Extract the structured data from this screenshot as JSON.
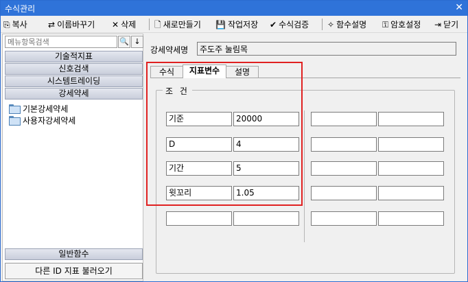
{
  "window": {
    "title": "수식관리",
    "close": "✕"
  },
  "toolbar": {
    "items": [
      {
        "icon": "copy-icon",
        "glyph": "⎘",
        "label": "복사"
      },
      {
        "icon": "rename-icon",
        "glyph": "⇄",
        "label": "이름바꾸기"
      },
      {
        "icon": "delete-icon",
        "glyph": "✕",
        "label": "삭제"
      },
      {
        "icon": "new-document-icon",
        "glyph": "🗋",
        "label": "새로만들기"
      },
      {
        "icon": "save-icon",
        "glyph": "💾",
        "label": "작업저장"
      },
      {
        "icon": "check-icon",
        "glyph": "✔",
        "label": "수식검증"
      },
      {
        "icon": "magic-wand-icon",
        "glyph": "✧",
        "label": "함수설명"
      },
      {
        "icon": "key-icon",
        "glyph": "⚿",
        "label": "암호설정"
      },
      {
        "icon": "exit-icon",
        "glyph": "⇥",
        "label": "닫기"
      }
    ]
  },
  "sidebar": {
    "search_placeholder": "메뉴항목검색",
    "search_glyph": "🔍",
    "down_glyph": "↓",
    "categories": [
      "기술적지표",
      "신호검색",
      "시스템트레이딩",
      "강세약세"
    ],
    "tree": [
      "기본강세약세",
      "사용자강세약세"
    ],
    "bottom_category": "일반함수",
    "load_button": "다른 ID 지표 불러오기"
  },
  "main": {
    "name_label": "강세약세명",
    "name_value": "주도주 눌림목",
    "tabs": [
      "수식",
      "지표변수",
      "설명"
    ],
    "active_tab": "지표변수",
    "group_title": "조 건",
    "left_rows": [
      {
        "name": "기준",
        "value": "20000"
      },
      {
        "name": "D",
        "value": "4"
      },
      {
        "name": "기간",
        "value": "5"
      },
      {
        "name": "윗꼬리",
        "value": "1.05"
      },
      {
        "name": "",
        "value": ""
      }
    ],
    "right_rows": [
      {
        "name": "",
        "value": ""
      },
      {
        "name": "",
        "value": ""
      },
      {
        "name": "",
        "value": ""
      },
      {
        "name": "",
        "value": ""
      },
      {
        "name": "",
        "value": ""
      }
    ]
  },
  "colors": {
    "titlebar": "#2f73d9",
    "highlight": "#e02020"
  }
}
